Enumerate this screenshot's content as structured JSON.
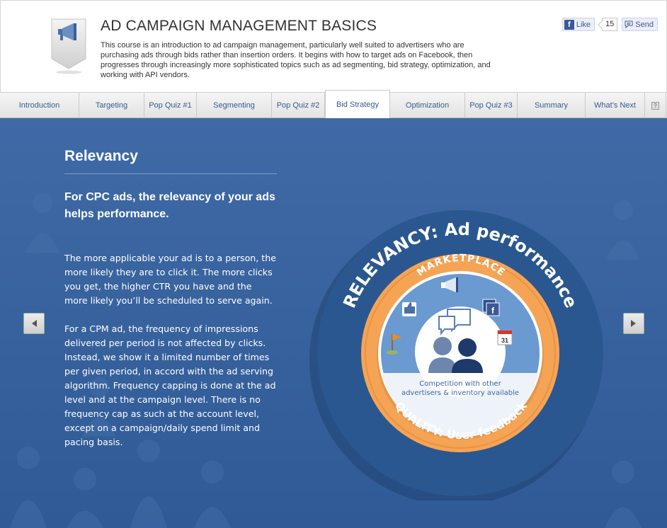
{
  "header": {
    "title": "AD CAMPAIGN MANAGEMENT BASICS",
    "description": "This course is an introduction to ad campaign management, particularly well suited to advertisers who are purchasing ads through bids rather than insertion orders. It begins with how to target ads on Facebook, then progresses through increasingly more sophisticated topics such as ad segmenting, bid strategy, optimization, and working with API vendors.",
    "icon": "megaphone-icon"
  },
  "social": {
    "like_label": "Like",
    "like_count": "15",
    "send_label": "Send"
  },
  "tabs": [
    {
      "label": "Introduction",
      "active": false
    },
    {
      "label": "Targeting",
      "active": false
    },
    {
      "label": "Pop Quiz #1",
      "active": false
    },
    {
      "label": "Segmenting",
      "active": false
    },
    {
      "label": "Pop Quiz #2",
      "active": false
    },
    {
      "label": "Bid Strategy",
      "active": true
    },
    {
      "label": "Optimization",
      "active": false
    },
    {
      "label": "Pop Quiz #3",
      "active": false
    },
    {
      "label": "Summary",
      "active": false
    },
    {
      "label": "What's Next",
      "active": false
    }
  ],
  "help_label": "?",
  "content": {
    "title": "Relevancy",
    "subtitle": "For CPC ads, the relevancy of your ads helps performance.",
    "paragraph1": "The more applicable your ad is to a person, the more likely they are to click it. The more clicks you get, the higher CTR you have and the more likely you’ll be scheduled to serve again.",
    "paragraph2": "For a CPM ad, the frequency of impressions delivered per period is not affected by clicks. Instead, we show it a limited number of times per given period, in accord with the ad serving algorithm. Frequency capping is done at the ad level and at the campaign level. There is no frequency cap as such at the account level, except on a campaign/daily spend limit and pacing basis."
  },
  "diagram": {
    "outer_label": "RELEVANCY: Ad performance",
    "bottom_label": "QUALITY:  User feedback",
    "inner_label": "MARKETPLACE",
    "caption_line1": "Competition with other",
    "caption_line2": "advertisers & inventory available",
    "calendar_day": "31",
    "colors": {
      "outer_ring": "#2a578f",
      "orange_ring": "#f5a456",
      "marketplace": "#6b9ad1",
      "center": "#ffffff",
      "people": "#2a4f86"
    }
  },
  "nav": {
    "prev_icon": "arrow-left-icon",
    "next_icon": "arrow-right-icon"
  }
}
